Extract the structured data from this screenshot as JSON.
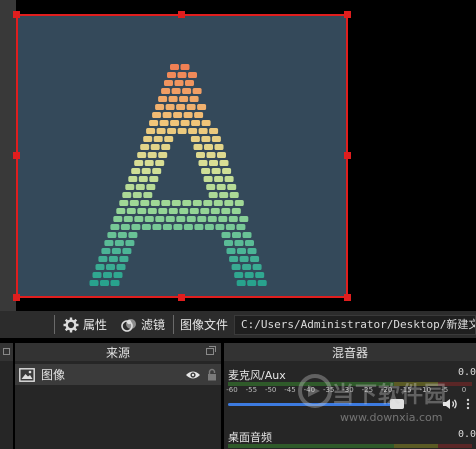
{
  "toolbar": {
    "properties_label": "属性",
    "filters_label": "滤镜",
    "source_type_label": "图像文件",
    "file_path": "C:/Users/Administrator/Desktop/新建文件"
  },
  "sources_dock": {
    "title": "来源",
    "items": [
      {
        "label": "图像",
        "icon": "image-icon",
        "visible": true,
        "locked": false
      }
    ]
  },
  "mixer_dock": {
    "title": "混音器",
    "channels": [
      {
        "name": "麦克风/Aux",
        "db": "0.0",
        "ticks": [
          "-60",
          "-55",
          "-50",
          "-45",
          "-40",
          "-35",
          "-30",
          "-25",
          "-20",
          "-15",
          "-10",
          "-5",
          "0"
        ],
        "volume": 0.82
      },
      {
        "name": "桌面音频",
        "db": "0.0"
      }
    ]
  },
  "watermark": {
    "site_name": "当下软件园",
    "url": "www.downxia.com"
  },
  "colors": {
    "selection": "#e01e1e",
    "canvas_bg": "#34495a",
    "fader": "#3d7be0"
  }
}
